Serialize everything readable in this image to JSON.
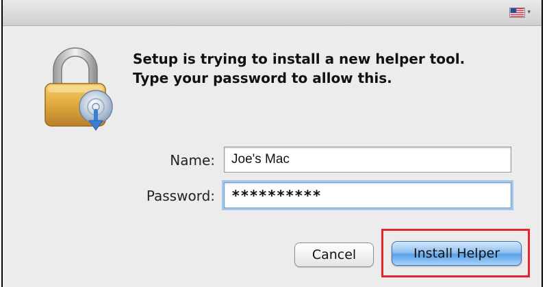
{
  "dialog": {
    "message_line1": "Setup is trying to install a new helper tool.",
    "message_line2": "Type your password to allow this."
  },
  "titlebar": {
    "input_menu_icon": "us-flag-icon",
    "input_menu_caret": "▾"
  },
  "form": {
    "name_label": "Name:",
    "name_value": "Joe's Mac",
    "password_label": "Password:",
    "password_value": "**********"
  },
  "buttons": {
    "cancel_label": "Cancel",
    "install_label": "Install Helper"
  },
  "icons": {
    "lock": "padlock-with-disc-icon"
  },
  "colors": {
    "window_bg": "#ececec",
    "default_button": "#5aa1e6",
    "focus_ring": "#a7c6ec",
    "annotation_outline": "#e3262e"
  }
}
